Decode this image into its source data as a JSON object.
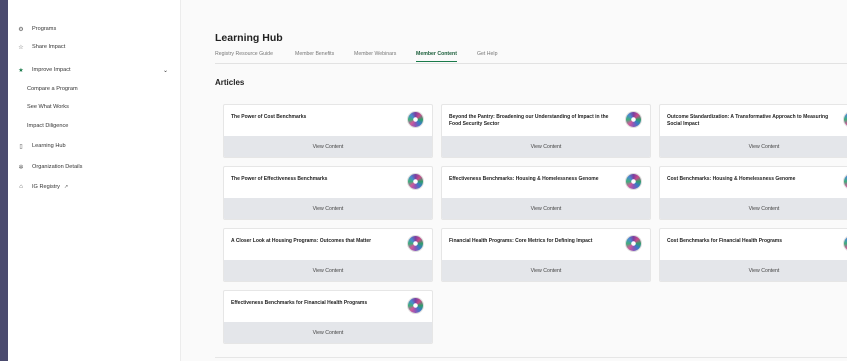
{
  "sidebar": {
    "items": [
      {
        "label": "Programs",
        "icon": "settings-icon"
      },
      {
        "label": "Share Impact",
        "icon": "star-icon"
      },
      {
        "label": "Improve Impact",
        "icon": "star-filled-icon"
      },
      {
        "label": "Learning Hub",
        "icon": "book-icon"
      },
      {
        "label": "Organization Details",
        "icon": "gear-icon"
      },
      {
        "label": "IG Registry",
        "icon": "registry-icon"
      }
    ],
    "subitems": [
      "Compare a Program",
      "See What Works",
      "Impact Diligence"
    ]
  },
  "page": {
    "title": "Learning Hub",
    "section": "Articles"
  },
  "tabs": [
    "Registry Resource Guide",
    "Member Benefits",
    "Member Webinars",
    "Member Content",
    "Get Help"
  ],
  "active_tab": "Member Content",
  "colors": {
    "accent": "#1a7a4a",
    "button_bg": "#e4e6ea",
    "backdrop": "#4a4a6e"
  },
  "articles": [
    {
      "title": "The Power of Cost Benchmarks",
      "button": "View Content"
    },
    {
      "title": "Beyond the Pantry: Broadening our Understanding of Impact in the Food Security Sector",
      "button": "View Content"
    },
    {
      "title": "Outcome Standardization: A Transformative Approach to Measuring Social Impact",
      "button": "View Content"
    },
    {
      "title": "The Power of Effectiveness Benchmarks",
      "button": "View Content"
    },
    {
      "title": "Effectiveness Benchmarks: Housing & Homelessness Genome",
      "button": "View Content"
    },
    {
      "title": "Cost Benchmarks: Housing & Homelessness Genome",
      "button": "View Content"
    },
    {
      "title": "A Closer Look at Housing Programs: Outcomes that Matter",
      "button": "View Content"
    },
    {
      "title": "Financial Health Programs: Core Metrics for Defining Impact",
      "button": "View Content"
    },
    {
      "title": "Cost Benchmarks for Financial Health Programs",
      "button": "View Content"
    },
    {
      "title": "Effectiveness Benchmarks for Financial Health Programs",
      "button": "View Content"
    }
  ]
}
